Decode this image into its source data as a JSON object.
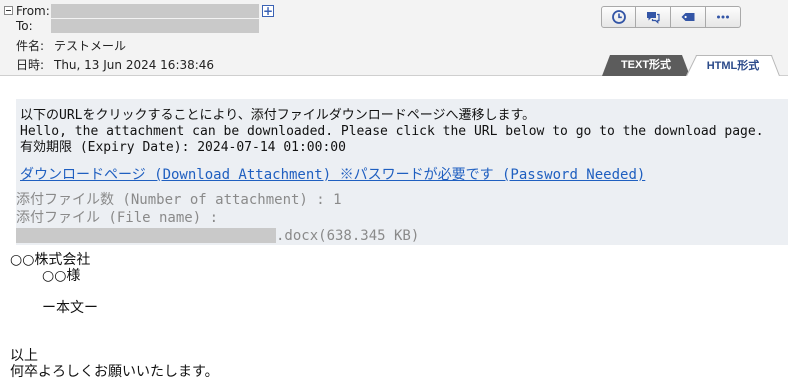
{
  "header": {
    "from_label": "From:",
    "to_label": "To:",
    "subject_label": "件名:",
    "subject_value": "テストメール",
    "date_label": "日時:",
    "date_value": "Thu, 13 Jun 2024 16:38:46",
    "expand_symbol": "+"
  },
  "toolbar": {
    "icons": [
      "clock-icon",
      "chat-bubble-icon",
      "tag-icon",
      "more-icon"
    ]
  },
  "tabs": {
    "text_tab": "TEXT形式",
    "html_tab": "HTML形式"
  },
  "notice": {
    "line_jp": "以下のURLをクリックすることにより、添付ファイルダウンロードページへ遷移します。",
    "line_en": "Hello, the attachment can be downloaded. Please click the URL below to go to the download page.",
    "expiry": "有効期限 (Expiry Date): 2024-07-14 01:00:00",
    "download_link": "ダウンロードページ (Download Attachment) ※パスワードが必要です (Password Needed)",
    "attachment_count": "添付ファイル数 (Number of attachment) : 1",
    "attachment_name_label": "添付ファイル (File name) :",
    "attachment_file_suffix": ".docx(638.345 KB)"
  },
  "letter": {
    "company": "○○株式会社",
    "recipient": "○○様",
    "body": "ー本文ー",
    "closing_1": "以上",
    "closing_2": "何卒よろしくお願いいたします。"
  }
}
